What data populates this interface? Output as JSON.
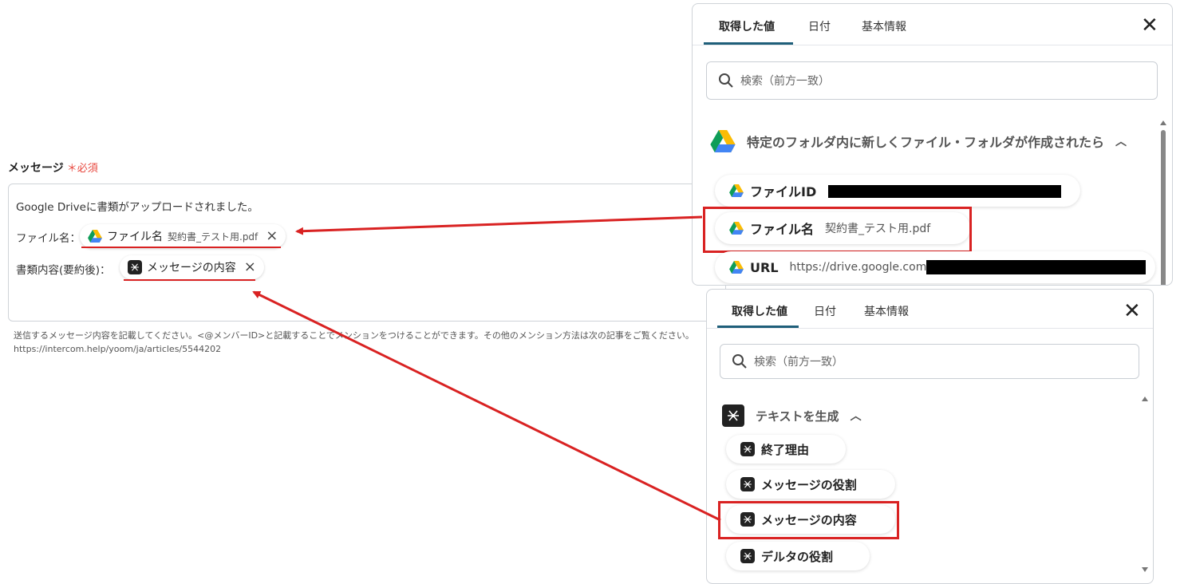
{
  "form": {
    "label": "メッセージ",
    "required": "＊必須",
    "line1": "Google Driveに書類がアップロードされました。",
    "line2_label": "ファイル名：",
    "line2_chip_name": "ファイル名",
    "line2_chip_value": "契約書_テスト用.pdf",
    "line3_label": "書類内容(要約後)：",
    "line3_chip_name": "メッセージの内容",
    "help_line1": "送信するメッセージ内容を記載してください。<@メンバーID>と記載することでメンションをつけることができます。その他のメンション方法は次の記事をご覧ください。",
    "help_line2": "https://intercom.help/yoom/ja/articles/5544202"
  },
  "panel_top": {
    "tabs": [
      "取得した値",
      "日付",
      "基本情報"
    ],
    "search_placeholder": "検索（前方一致）",
    "section_title": "特定のフォルダ内に新しくファイル・フォルダが作成されたら",
    "items": [
      {
        "label": "ファイルID",
        "value": ""
      },
      {
        "label": "ファイル名",
        "value": "契約書_テスト用.pdf"
      },
      {
        "label": "URL",
        "value": "https://drive.google.com/"
      }
    ]
  },
  "panel_bottom": {
    "tabs": [
      "取得した値",
      "日付",
      "基本情報"
    ],
    "search_placeholder": "検索（前方一致）",
    "section_title": "テキストを生成",
    "items": [
      {
        "label": "終了理由"
      },
      {
        "label": "メッセージの役割"
      },
      {
        "label": "メッセージの内容"
      },
      {
        "label": "デルタの役割"
      }
    ]
  },
  "colors": {
    "required": "#e8483f",
    "highlight": "#d92222",
    "tab_active": "#1f5f7a"
  },
  "icons": {
    "drive": "google-drive-icon",
    "ai": "ai-text-icon",
    "search": "search-icon",
    "close": "close-icon",
    "remove": "remove-x-icon",
    "chevron": "chevron-up-icon"
  }
}
